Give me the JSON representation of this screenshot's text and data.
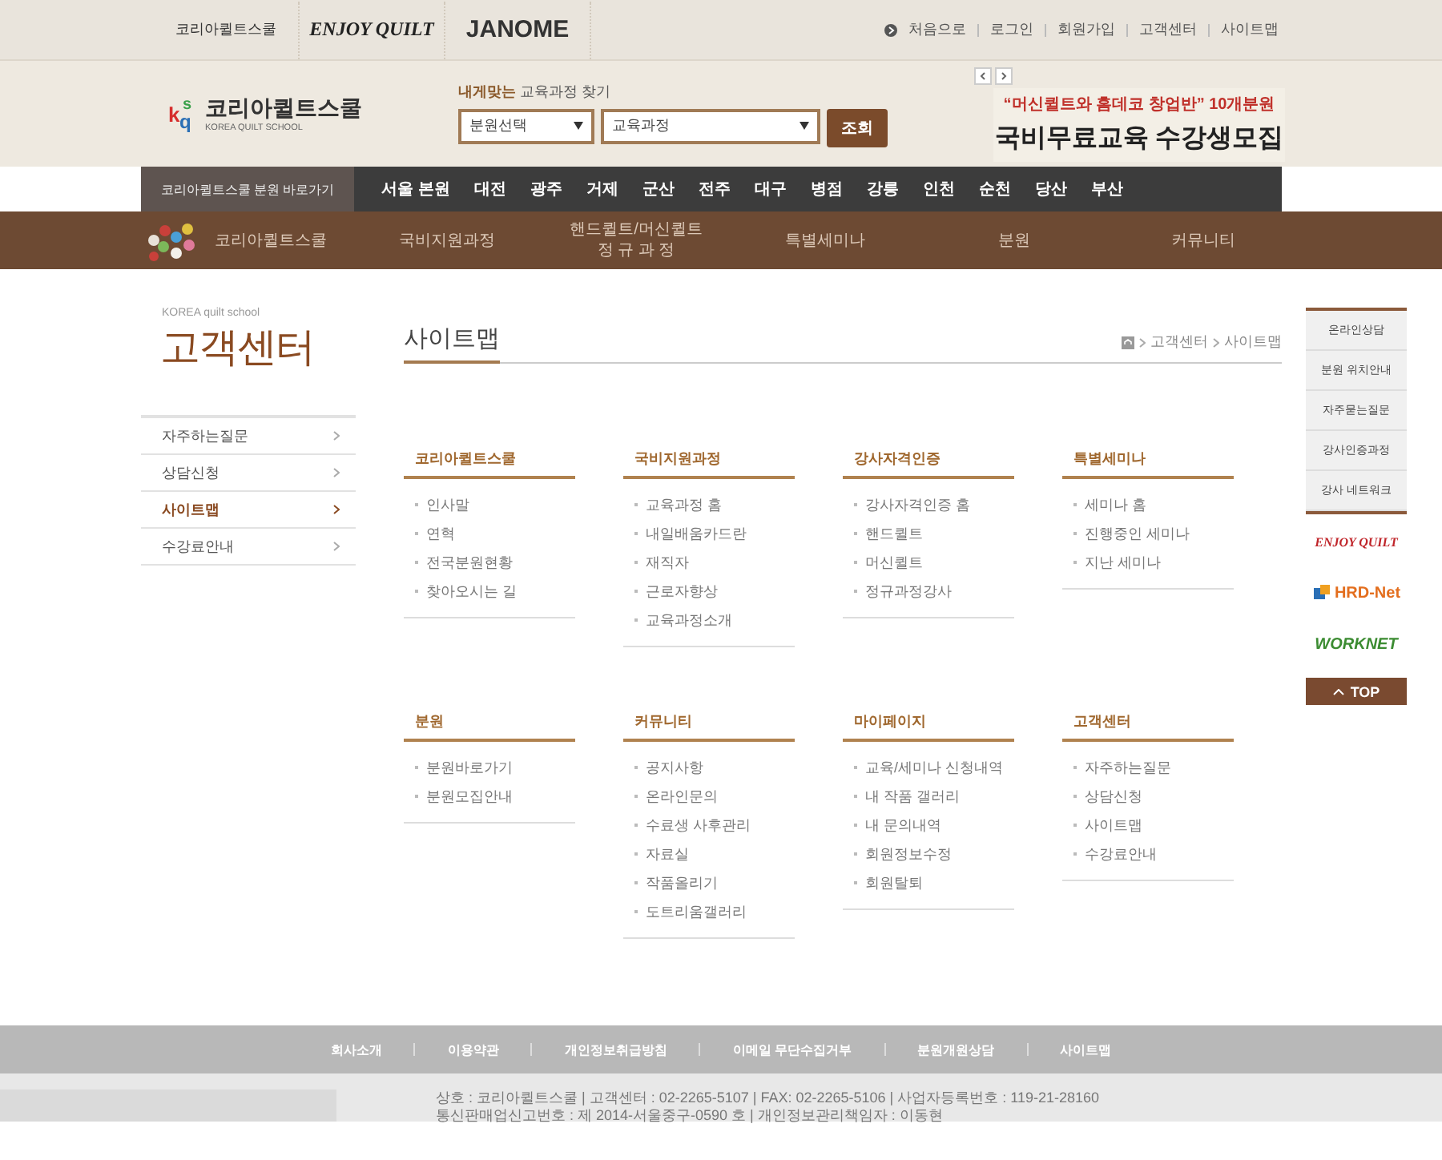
{
  "top_bar": {
    "partner_logos": [
      {
        "kind": "kqs",
        "text": "코리아퀼트스쿨"
      },
      {
        "kind": "enjoy",
        "text": "ENJOY QUILT"
      },
      {
        "kind": "janome",
        "text": "JANOME"
      }
    ],
    "links": [
      "처음으로",
      "로그인",
      "회원가입",
      "고객센터",
      "사이트맵"
    ]
  },
  "header": {
    "logo": {
      "mark": [
        "k",
        "s",
        "q"
      ],
      "name": "코리아퀼트스쿨",
      "sub": "KOREA QUILT SCHOOL"
    },
    "search": {
      "title": "**내게맞는** 교육과정 찾기",
      "branch_select": "분원선택",
      "course_select": "교육과정",
      "button": "조회"
    },
    "banner": {
      "line1": "“머신퀼트와 홈데코 창업반” 10개분원",
      "line2": "국비무료교육 수강생모집"
    }
  },
  "branch_bar": {
    "label": "코리아퀼트스쿨 분원 바로가기",
    "items": [
      "서울 본원",
      "대전",
      "광주",
      "거제",
      "군산",
      "전주",
      "대구",
      "병점",
      "강릉",
      "인천",
      "순천",
      "당산",
      "부산"
    ]
  },
  "main_nav": [
    {
      "lines": [
        "코리아퀼트스쿨"
      ]
    },
    {
      "lines": [
        "국비지원과정"
      ]
    },
    {
      "lines": [
        "핸드퀼트/머신퀼트",
        "정 규 과 정"
      ]
    },
    {
      "lines": [
        "특별세미나"
      ]
    },
    {
      "lines": [
        "분원"
      ]
    },
    {
      "lines": [
        "커뮤니티"
      ]
    }
  ],
  "sidebar": {
    "subtitle": "KOREA quilt school",
    "title": "고객센터",
    "items": [
      {
        "label": "자주하는질문",
        "selected": false
      },
      {
        "label": "상담신청",
        "selected": false
      },
      {
        "label": "사이트맵",
        "selected": true
      },
      {
        "label": "수강료안내",
        "selected": false
      }
    ]
  },
  "page": {
    "title": "사이트맵",
    "breadcrumb": [
      "고객센터",
      "사이트맵"
    ]
  },
  "sitemap": [
    {
      "title": "코리아퀼트스쿨",
      "links": [
        "인사말",
        "연혁",
        "전국분원현황",
        "찾아오시는 길"
      ]
    },
    {
      "title": "국비지원과정",
      "links": [
        "교육과정 홈",
        "내일배움카드란",
        "재직자",
        "근로자향상",
        "교육과정소개"
      ]
    },
    {
      "title": "강사자격인증",
      "links": [
        "강사자격인증 홈",
        "핸드퀼트",
        "머신퀼트",
        "정규과정강사"
      ]
    },
    {
      "title": "특별세미나",
      "links": [
        "세미나 홈",
        "진행중인 세미나",
        "지난 세미나"
      ]
    },
    {
      "title": "분원",
      "links": [
        "분원바로가기",
        "분원모집안내"
      ]
    },
    {
      "title": "커뮤니티",
      "links": [
        "공지사항",
        "온라인문의",
        "수료생 사후관리",
        "자료실",
        "작품올리기",
        "도트리움갤러리"
      ]
    },
    {
      "title": "마이페이지",
      "links": [
        "교육/세미나 신청내역",
        "내 작품 갤러리",
        "내 문의내역",
        "회원정보수정",
        "회원탈퇴"
      ]
    },
    {
      "title": "고객센터",
      "links": [
        "자주하는질문",
        "상담신청",
        "사이트맵",
        "수강료안내"
      ]
    }
  ],
  "quick_menu": {
    "items": [
      "온라인상담",
      "분원 위치안내",
      "자주묻는질문",
      "강사인증과정",
      "강사 네트워크"
    ],
    "logos": [
      {
        "kind": "enjoy",
        "text": "ENJOY QUILT"
      },
      {
        "kind": "hrd",
        "text": "HRD-Net"
      },
      {
        "kind": "worknet",
        "text": "WORKNET"
      }
    ],
    "top_button": "TOP"
  },
  "footer": {
    "links": [
      "회사소개",
      "이용약관",
      "개인정보취급방침",
      "이메일 무단수집거부",
      "분원개원상담",
      "사이트맵"
    ],
    "info": [
      "상호 : 코리아퀼트스쿨 | 고객센터 : 02-2265-5107 | FAX: 02-2265-5106 | 사업자등록번호 : 119-21-28160",
      "통신판매업신고번호 : 제 2014-서울중구-0590 호 | 개인정보관리책임자 : 이동현"
    ]
  }
}
